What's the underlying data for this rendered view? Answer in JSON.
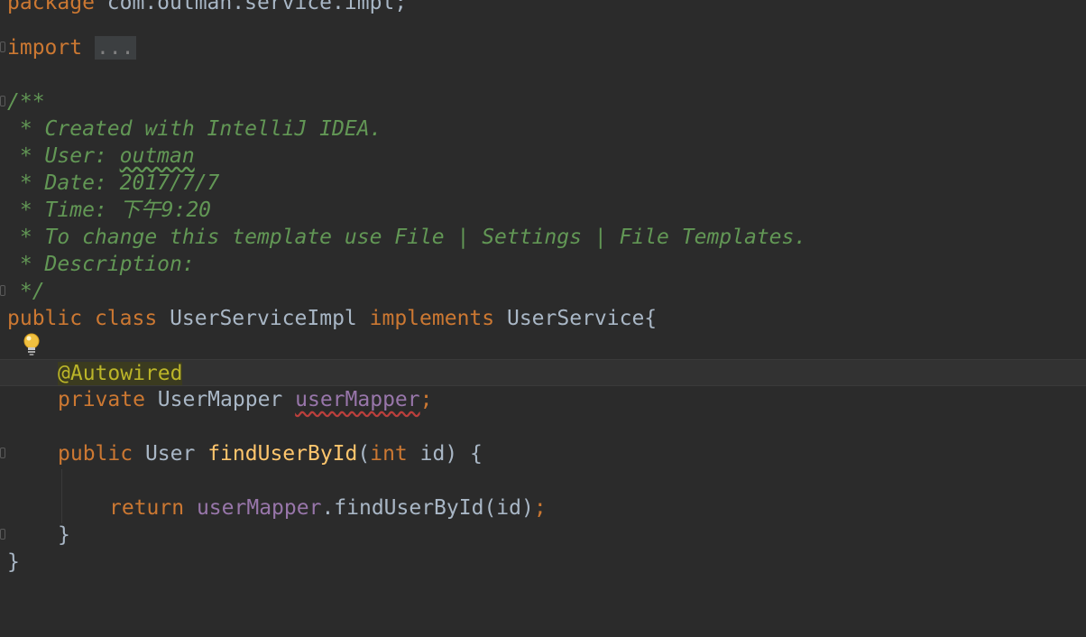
{
  "lines": {
    "package_kw": "package",
    "package_name": " com.outman.service.impl;",
    "import_kw": "import",
    "import_fold": "...",
    "c_open": "/**",
    "c_created": " * Created with IntelliJ IDEA.",
    "c_user_prefix": " * User: ",
    "c_user_name": "outman",
    "c_date": " * Date: 2017/7/7",
    "c_time": " * Time: 下午9:20",
    "c_template": " * To change this template use File | Settings | File Templates.",
    "c_description": " * Description:",
    "c_close": " */",
    "class_public": "public",
    "class_class": "class",
    "class_name": "UserServiceImpl",
    "class_implements": "implements",
    "class_iface": "UserService{",
    "annotation": "@Autowired",
    "field_private": "private",
    "field_type": "UserMapper",
    "field_name": "userMapper",
    "field_semi": ";",
    "method_public": "public",
    "method_type": "User",
    "method_name": "findUserById",
    "method_paren_open": "(",
    "method_int": "int",
    "method_params": " id) {",
    "return_kw": "return",
    "return_field": "userMapper",
    "return_call": ".findUserById(id)",
    "return_semi": ";",
    "method_close": "}",
    "class_close": "}"
  },
  "icons": {
    "intention": "lightbulb-icon",
    "fold": "fold-marker-icon"
  },
  "colors": {
    "background": "#2b2b2b",
    "keyword": "#cc7832",
    "comment": "#629755",
    "annotation": "#bbb529",
    "field": "#9876aa",
    "method": "#ffc66d",
    "text": "#a9b7c6"
  }
}
